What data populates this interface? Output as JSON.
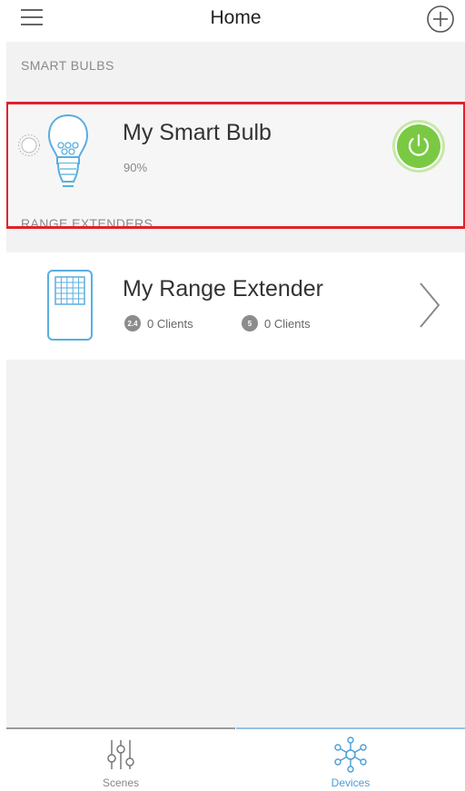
{
  "header": {
    "title": "Home",
    "menu_icon": "hamburger-icon",
    "add_icon": "plus-circle-icon"
  },
  "sections": {
    "smart_bulbs": "SMART BULBS",
    "range_extenders": "RANGE EXTENDERS"
  },
  "bulb": {
    "name": "My Smart Bulb",
    "level": "90%",
    "level_fraction": 0.9,
    "icon": "smart-bulb-icon",
    "power_icon": "power-icon",
    "power_on": true
  },
  "extender": {
    "name": "My Range Extender",
    "icon": "range-extender-icon",
    "band_24_badge": "2.4",
    "band_24_clients": "0 Clients",
    "band_5_badge": "5",
    "band_5_clients": "0 Clients"
  },
  "tabs": [
    {
      "label": "Scenes",
      "icon": "sliders-icon",
      "active": false
    },
    {
      "label": "Devices",
      "icon": "network-icon",
      "active": true
    }
  ],
  "colors": {
    "highlight": "#e2212a",
    "power_green": "#7ac943",
    "accent_blue": "#4a9ed8"
  }
}
